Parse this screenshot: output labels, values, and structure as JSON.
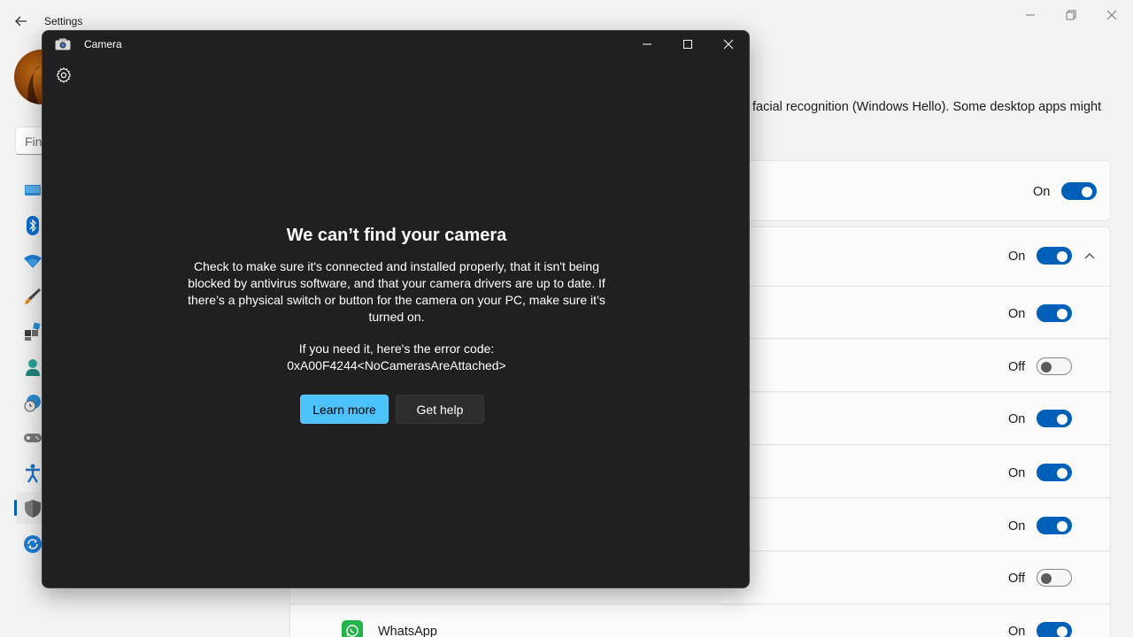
{
  "settings": {
    "title": "Settings",
    "search_placeholder": "Fin",
    "description": "facial recognition (Windows Hello). Some desktop apps might",
    "rows": [
      {
        "state": "On"
      },
      {
        "state": "On"
      },
      {
        "state": "On"
      },
      {
        "state": "Off"
      },
      {
        "state": "On"
      },
      {
        "state": "On"
      },
      {
        "state": "On"
      },
      {
        "state": "Off"
      },
      {
        "state": "On",
        "app": "WhatsApp"
      }
    ]
  },
  "camera": {
    "title": "Camera",
    "error_title": "We can’t find your camera",
    "error_body": "Check to make sure it's connected and installed properly, that it isn't being blocked by antivirus software, and that your camera drivers are up to date. If there’s a physical switch or button for the camera on your PC, make sure it’s turned on.",
    "error_code_intro": "If you need it, here's the error code:",
    "error_code": "0xA00F4244<NoCamerasAreAttached>",
    "learn_more": "Learn more",
    "get_help": "Get help"
  },
  "colors": {
    "accent": "#005fb8",
    "camera_bg": "#202020",
    "primary_button": "#4cc2ff"
  }
}
